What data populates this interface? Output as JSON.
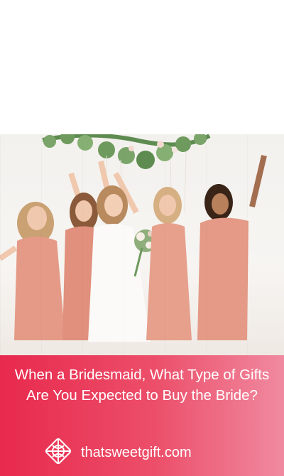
{
  "article": {
    "title": "When a Bridesmaid, What Type of Gifts Are You Expected to Buy the Bride?"
  },
  "brand": {
    "site": "thatsweetgift.com",
    "logo_icon": "gift-knot-icon"
  },
  "photo": {
    "subject_icon": "bridal-party-photo",
    "colors": {
      "dress": "#e49a86",
      "gown": "#fbfaf8",
      "greenery": "#6f9a5e",
      "wall": "#f4f2ef"
    }
  },
  "colors": {
    "banner_start": "#e8294d",
    "banner_end": "#f08aa0",
    "text": "#ffffff"
  }
}
